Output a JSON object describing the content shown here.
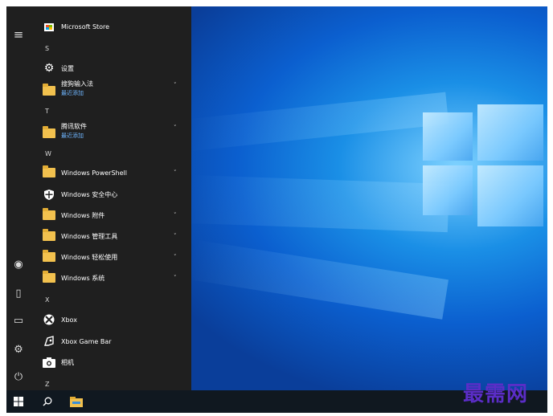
{
  "top_stub": "…",
  "rail": {
    "items": [
      {
        "icon": "hamburger-menu-icon",
        "glyph": "≡"
      },
      {
        "icon": "user-account-icon",
        "glyph": "◉"
      },
      {
        "icon": "documents-icon",
        "glyph": "▯"
      },
      {
        "icon": "pictures-icon",
        "glyph": "▭"
      },
      {
        "icon": "settings-gear-icon",
        "glyph": "⚙"
      },
      {
        "icon": "power-icon",
        "glyph": "⏻"
      }
    ]
  },
  "apps": {
    "microsoft_store": "Microsoft Store",
    "letter_s": "S",
    "settings": "设置",
    "sogou": "搜狗输入法",
    "sogou_sub": "最近添加",
    "letter_t": "T",
    "tencent": "腾讯软件",
    "tencent_sub": "最近添加",
    "letter_w": "W",
    "powershell": "Windows PowerShell",
    "security": "Windows 安全中心",
    "accessories": "Windows 附件",
    "admin_tools": "Windows 管理工具",
    "ease_access": "Windows 轻松使用",
    "system": "Windows 系统",
    "letter_x": "X",
    "xbox": "Xbox",
    "xbox_game_bar": "Xbox Game Bar",
    "camera": "相机",
    "letter_z": "Z",
    "chevron": "˅"
  },
  "taskbar": {
    "start_glyph": "⊞",
    "search_glyph": "⌕",
    "explorer_glyph": "▬"
  },
  "watermark": "最需网",
  "colors": {
    "menu_bg": "#1f1f1f",
    "accent_sub": "#6fb6ff",
    "folder": "#f2c14e",
    "taskbar": "#101820",
    "watermark": "#5b2dc7"
  }
}
